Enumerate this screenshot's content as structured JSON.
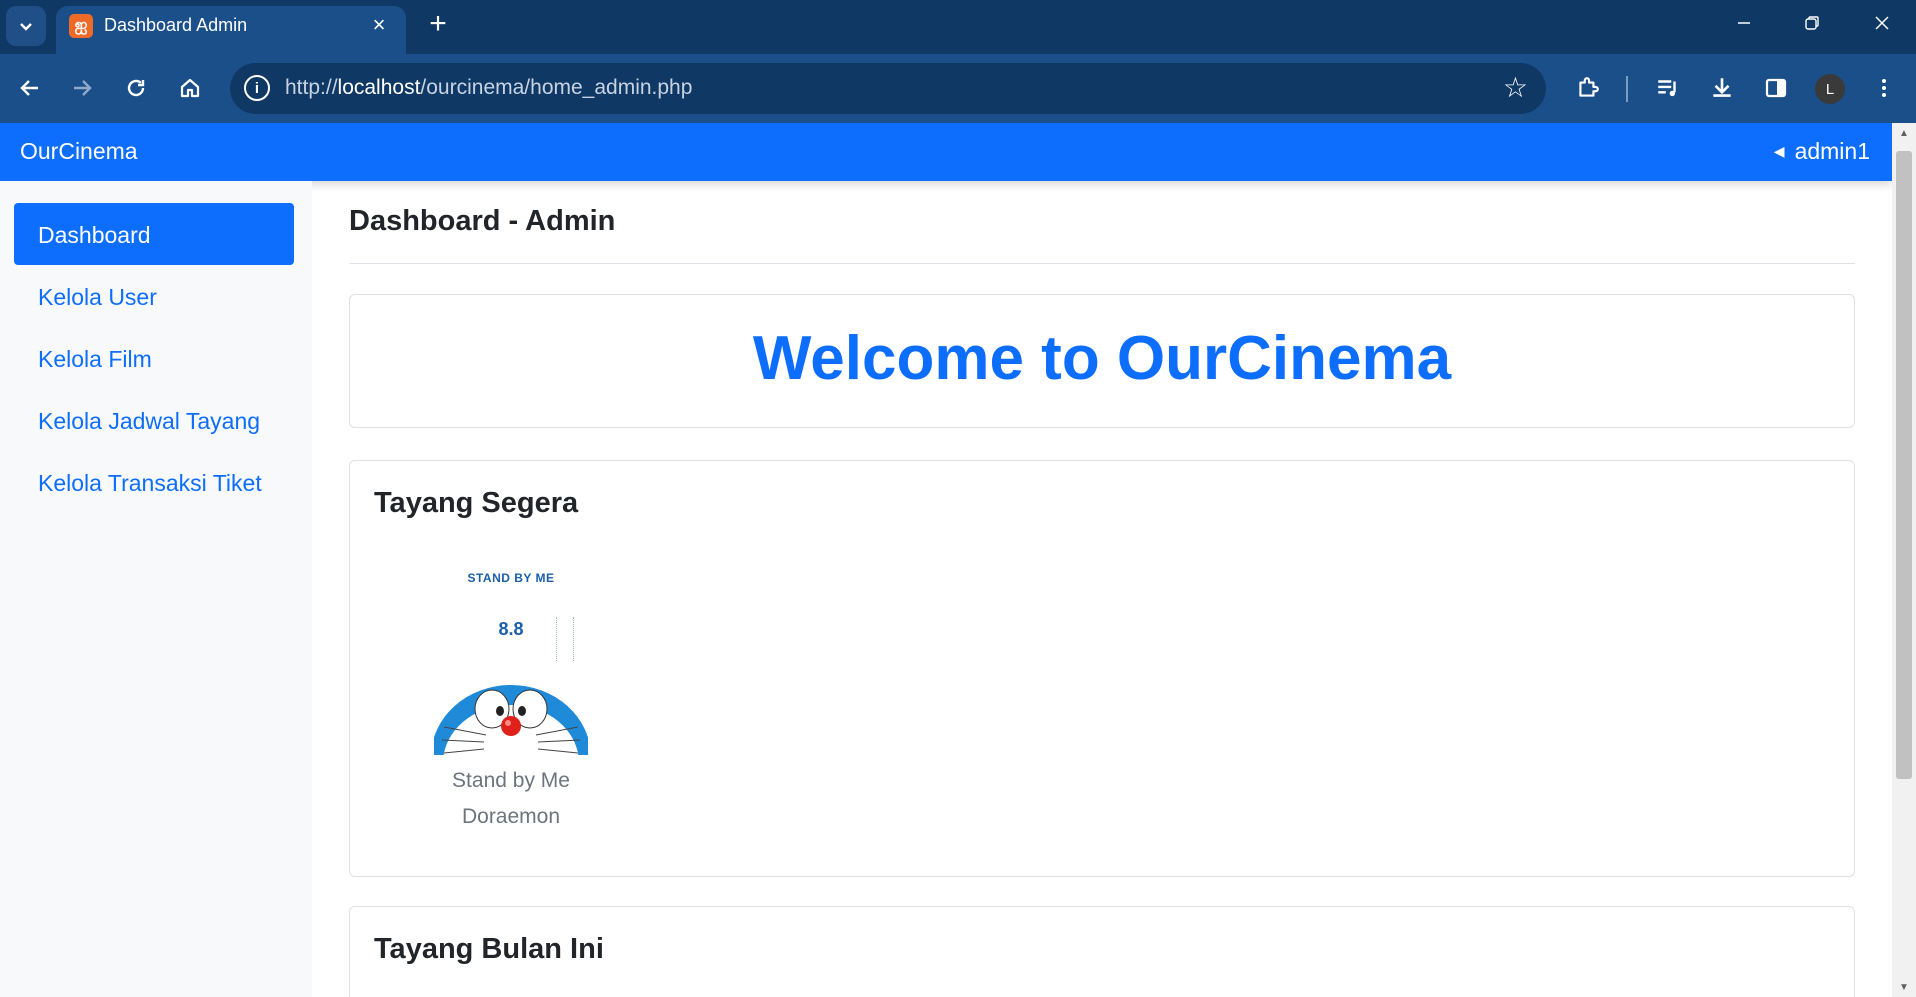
{
  "browser": {
    "tab_title": "Dashboard Admin",
    "url_scheme": "http://",
    "url_host": "localhost",
    "url_path": "/ourcinema/home_admin.php",
    "profile_initial": "L"
  },
  "navbar": {
    "brand": "OurCinema",
    "user": "admin1"
  },
  "sidebar": {
    "items": [
      {
        "label": "Dashboard",
        "active": true
      },
      {
        "label": "Kelola User",
        "active": false
      },
      {
        "label": "Kelola Film",
        "active": false
      },
      {
        "label": "Kelola Jadwal Tayang",
        "active": false
      },
      {
        "label": "Kelola Transaksi Tiket",
        "active": false
      }
    ]
  },
  "main": {
    "page_title": "Dashboard - Admin",
    "welcome": "Welcome to OurCinema",
    "sections": [
      {
        "heading": "Tayang Segera",
        "movies": [
          {
            "title_line1": "Stand by Me",
            "title_line2": "Doraemon",
            "poster_title": "STAND BY ME",
            "poster_date": "8.8"
          }
        ]
      },
      {
        "heading": "Tayang Bulan Ini",
        "movies": []
      }
    ]
  },
  "colors": {
    "primary": "#0d6efd",
    "sidebar_bg": "#f8f9fa",
    "browser_frame": "#0f3864",
    "browser_toolbar": "#1b4f8a"
  }
}
